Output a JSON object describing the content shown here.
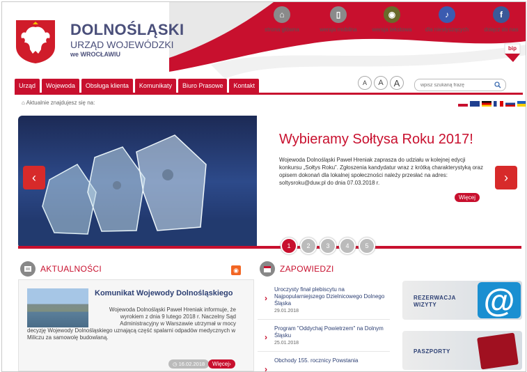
{
  "header": {
    "title_line1": "DOLNOŚLĄSKI",
    "title_line2": "URZĄD WOJEWÓDZKI",
    "title_line3": "we WROCŁAWIU"
  },
  "top_nav": [
    {
      "label": "strona główna",
      "icon": "home-icon",
      "color": "#8a8a8a"
    },
    {
      "label": "wersja mobilna",
      "icon": "mobile-icon",
      "color": "#8a8a8a"
    },
    {
      "label": "wersja tekstowa",
      "icon": "eye-icon",
      "color": "#6a6a2a"
    },
    {
      "label": "dla niesłyszących",
      "icon": "hearing-icon",
      "color": "#3b5bb0"
    },
    {
      "label": "dołącz do nas",
      "icon": "facebook-icon",
      "color": "#3b5998"
    }
  ],
  "bip_label": "bip",
  "menu": [
    "Urząd",
    "Wojewoda",
    "Obsługa klienta",
    "Komunikaty",
    "Biuro Prasowe",
    "Kontakt"
  ],
  "font_sizes": [
    "A",
    "A",
    "A"
  ],
  "search": {
    "placeholder": "wpisz szukaną frazę"
  },
  "breadcrumb": "⌂ Aktualnie znajdujesz się na:",
  "slider": {
    "title": "Wybieramy Sołtysa Roku 2017!",
    "text": "Wojewoda Dolnośląski Paweł Hreniak zaprasza do udziału w kolejnej edycji konkursu „Sołtys Roku”. Zgłoszenia kandydatur wraz z krótką charakterystyką oraz opisem dokonań dla lokalnej społeczności należy przesłać na adres: soltysroku@duw.pl do dnia 07.03.2018 r.",
    "more": "Więcej",
    "dots": [
      "1",
      "2",
      "3",
      "4",
      "5"
    ],
    "active_dot": 1
  },
  "news": {
    "section_title": "AKTUALNOŚCI",
    "item_title": "Komunikat Wojewody Dolnośląskiego",
    "item_text_a": "Wojewoda Dolnośląski Paweł Hreniak informuje, że wyrokiem z dnia 9 lutego 2018 r. Naczelny Sąd Administracyjny w Warszawie utrzymał w mocy",
    "item_text_b": "decyzję Wojewody Dolnośląskiego uznającą część spalarni odpadów medycznych w Miliczu za samowolę budowlaną.",
    "date": "◷ 16.02.2018",
    "more": "Więcej›"
  },
  "events": {
    "section_title": "ZAPOWIEDZI",
    "items": [
      {
        "title": "Uroczysty finał plebiscytu na Najpopularniejszego Dzielnicowego Dolnego Śląska",
        "date": "29.01.2018"
      },
      {
        "title": "Program \"Oddychaj Powietrzem\" na Dolnym Śląsku",
        "date": "25.01.2018"
      },
      {
        "title": "Obchody 155. rocznicy Powstania",
        "date": ""
      }
    ]
  },
  "tiles": [
    {
      "label": "REZERWACJA WIZYTY"
    },
    {
      "label": "PASZPORTY"
    }
  ]
}
